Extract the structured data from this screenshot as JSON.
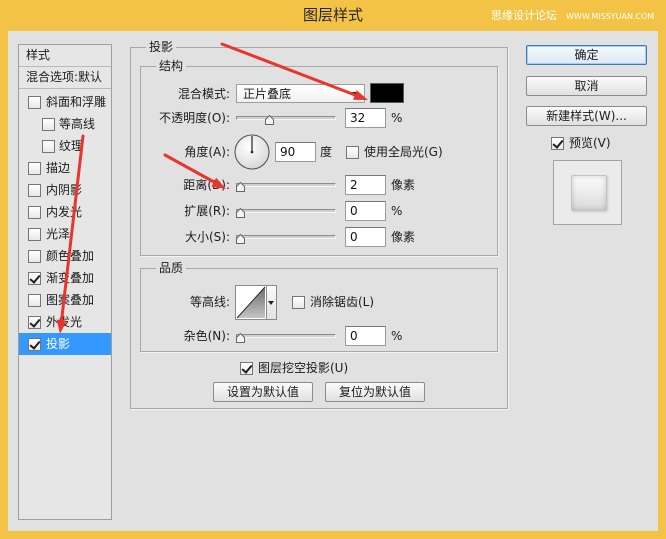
{
  "window": {
    "title": "图层样式",
    "watermark": {
      "name": "思缘设计论坛",
      "url": "WWW.MISSYUAN.COM"
    }
  },
  "theme": {
    "accent": "#f2c345",
    "selection": "#3399ff",
    "annotation_arrows": "#e8352e"
  },
  "icons": {
    "blend_mode_dropdown": "triangle-down-icon",
    "angle_dial": "angle-dial-icon",
    "contour_picker": "linear-contour-icon",
    "annotations": "red-arrow-icon"
  },
  "styles_panel": {
    "header": "样式",
    "blending_options": "混合选项:默认",
    "items": [
      {
        "label": "斜面和浮雕",
        "checked": false,
        "sub_items": [
          {
            "label": "等高线",
            "checked": false
          },
          {
            "label": "纹理",
            "checked": false
          }
        ]
      },
      {
        "label": "描边",
        "checked": false
      },
      {
        "label": "内阴影",
        "checked": false
      },
      {
        "label": "内发光",
        "checked": false
      },
      {
        "label": "光泽",
        "checked": false
      },
      {
        "label": "颜色叠加",
        "checked": false
      },
      {
        "label": "渐变叠加",
        "checked": true
      },
      {
        "label": "图案叠加",
        "checked": false
      },
      {
        "label": "外发光",
        "checked": true
      },
      {
        "label": "投影",
        "checked": true,
        "selected": true
      }
    ]
  },
  "drop_shadow": {
    "group_title": "投影",
    "structure": {
      "title": "结构",
      "blend_mode": {
        "label": "混合模式:",
        "value": "正片叠底",
        "color": "#000000"
      },
      "opacity": {
        "label": "不透明度(O):",
        "value": 32,
        "unit": "%"
      },
      "angle": {
        "label": "角度(A):",
        "value": 90,
        "unit": "度",
        "use_global_light": {
          "label": "使用全局光(G)",
          "checked": false
        }
      },
      "distance": {
        "label": "距离(D):",
        "value": 2,
        "unit": "像素"
      },
      "spread": {
        "label": "扩展(R):",
        "value": 0,
        "unit": "%"
      },
      "size": {
        "label": "大小(S):",
        "value": 0,
        "unit": "像素"
      }
    },
    "quality": {
      "title": "品质",
      "contour": {
        "label": "等高线:",
        "anti_aliased": {
          "label": "消除锯齿(L)",
          "checked": false
        }
      },
      "noise": {
        "label": "杂色(N):",
        "value": 0,
        "unit": "%"
      }
    },
    "layer_knocks_out": {
      "label": "图层挖空投影(U)",
      "checked": true
    },
    "make_default": "设置为默认值",
    "reset_default": "复位为默认值"
  },
  "actions": {
    "ok": "确定",
    "cancel": "取消",
    "new_style": "新建样式(W)...",
    "preview": {
      "label": "预览(V)",
      "checked": true
    }
  }
}
